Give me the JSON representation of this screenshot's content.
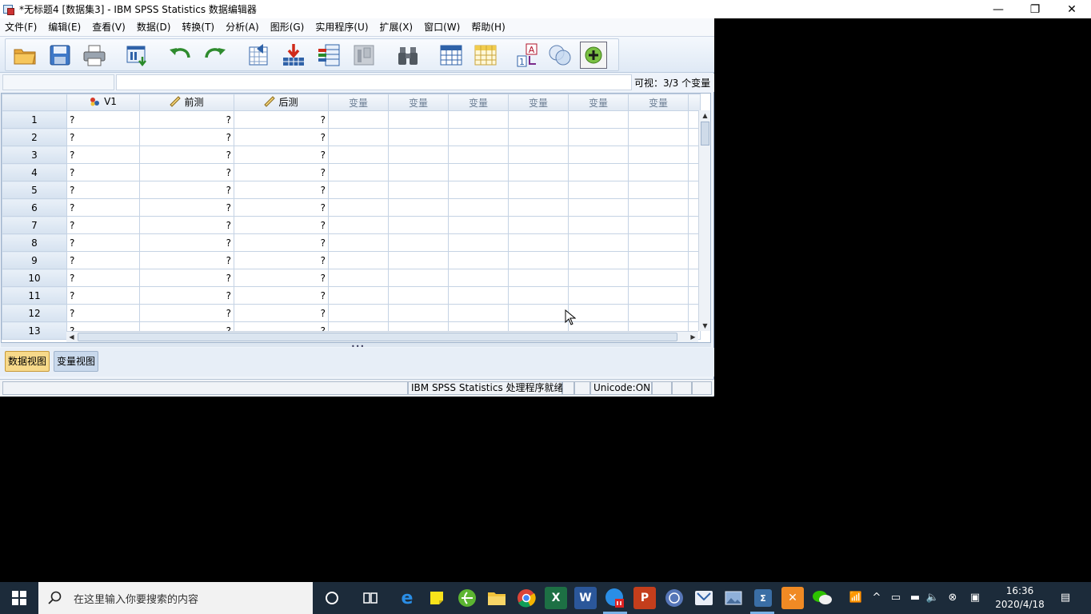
{
  "window": {
    "title": "*无标题4 [数据集3] - IBM SPSS Statistics 数据编辑器",
    "minimize": "—",
    "restore": "❐",
    "close": "✕"
  },
  "menubar": [
    "文件(F)",
    "编辑(E)",
    "查看(V)",
    "数据(D)",
    "转换(T)",
    "分析(A)",
    "图形(G)",
    "实用程序(U)",
    "扩展(X)",
    "窗口(W)",
    "帮助(H)"
  ],
  "cellbar": {
    "cell_ref": "",
    "cell_value": "",
    "visible_count": "可视：3/3 个变量"
  },
  "grid": {
    "columns": [
      {
        "name": "V1",
        "type": "nominal"
      },
      {
        "name": "前测",
        "type": "scale"
      },
      {
        "name": "后测",
        "type": "scale"
      },
      {
        "name": "变量",
        "type": "empty"
      },
      {
        "name": "变量",
        "type": "empty"
      },
      {
        "name": "变量",
        "type": "empty"
      },
      {
        "name": "变量",
        "type": "empty"
      },
      {
        "name": "变量",
        "type": "empty"
      },
      {
        "name": "变量",
        "type": "empty"
      }
    ],
    "rows": [
      {
        "num": "1",
        "cells": [
          "?",
          "?",
          "?"
        ]
      },
      {
        "num": "2",
        "cells": [
          "?",
          "?",
          "?"
        ]
      },
      {
        "num": "3",
        "cells": [
          "?",
          "?",
          "?"
        ]
      },
      {
        "num": "4",
        "cells": [
          "?",
          "?",
          "?"
        ]
      },
      {
        "num": "5",
        "cells": [
          "?",
          "?",
          "?"
        ]
      },
      {
        "num": "6",
        "cells": [
          "?",
          "?",
          "?"
        ]
      },
      {
        "num": "7",
        "cells": [
          "?",
          "?",
          "?"
        ]
      },
      {
        "num": "8",
        "cells": [
          "?",
          "?",
          "?"
        ]
      },
      {
        "num": "9",
        "cells": [
          "?",
          "?",
          "?"
        ]
      },
      {
        "num": "10",
        "cells": [
          "?",
          "?",
          "?"
        ]
      },
      {
        "num": "11",
        "cells": [
          "?",
          "?",
          "?"
        ]
      },
      {
        "num": "12",
        "cells": [
          "?",
          "?",
          "?"
        ]
      },
      {
        "num": "13",
        "cells": [
          "?",
          "?",
          "?"
        ]
      }
    ]
  },
  "tabs": {
    "data_view": "数据视图",
    "variable_view": "变量视图"
  },
  "statusbar": {
    "processor": "IBM SPSS Statistics 处理程序就绪",
    "unicode": "Unicode:ON"
  },
  "taskbar": {
    "search_placeholder": "在这里输入你要搜索的内容",
    "time": "16:36",
    "date": "2020/4/18"
  },
  "colors": {
    "accent": "#f7d98a",
    "header": "#e1e9f3",
    "taskbar": "#1c2b3a"
  }
}
